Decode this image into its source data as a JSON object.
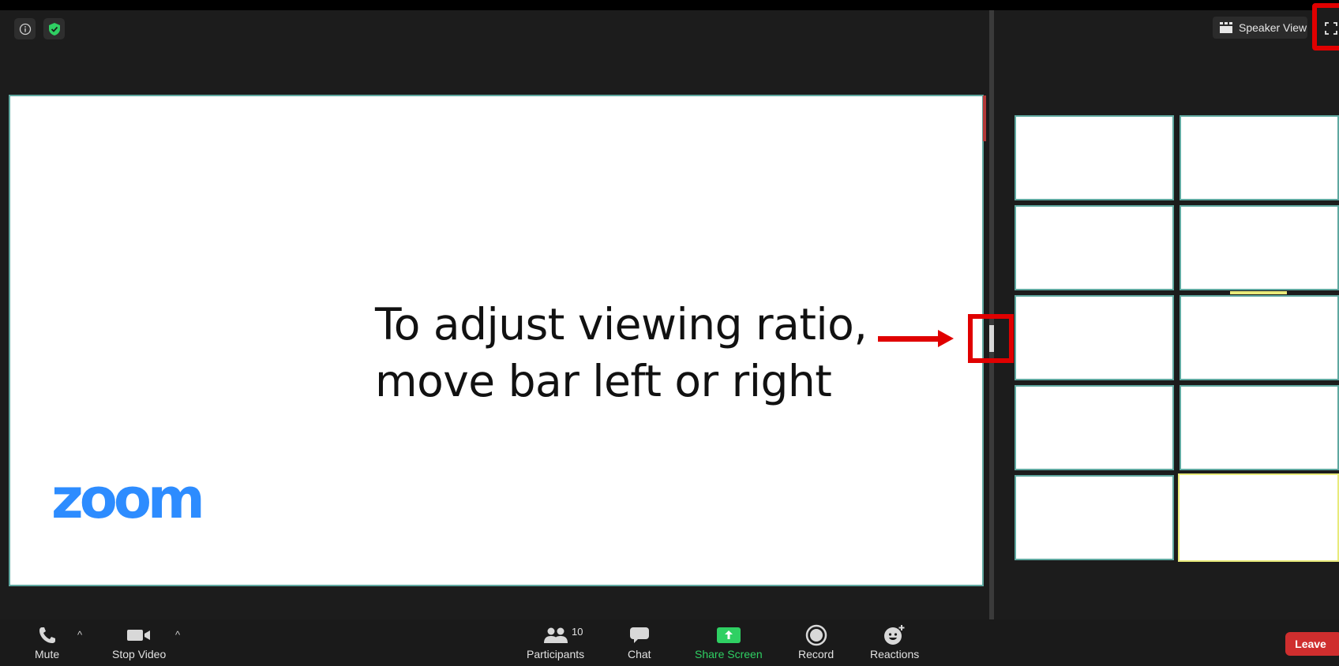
{
  "meeting": {
    "main_text_line1": "To adjust viewing ratio,",
    "main_text_line2": "move bar left or right",
    "logo_text": "zoom"
  },
  "header": {
    "info_icon": "info-icon",
    "security_icon": "shield-check-icon",
    "view_button_label": "Speaker View",
    "fullscreen_icon": "fullscreen-icon"
  },
  "gallery": {
    "tile_count": 10,
    "active_tile_index": 9
  },
  "toolbar": {
    "mute_label": "Mute",
    "stop_video_label": "Stop Video",
    "participants_label": "Participants",
    "participants_count": "10",
    "chat_label": "Chat",
    "share_screen_label": "Share Screen",
    "record_label": "Record",
    "reactions_label": "Reactions",
    "leave_label": "Leave"
  },
  "colors": {
    "background": "#1c1c1c",
    "accent_blue": "#2d8cff",
    "share_green": "#2fd063",
    "leave_red": "#cf2e2e",
    "annotation_red": "#e00000",
    "tile_border": "#5fa8a0",
    "active_speaker": "#e8ea7a"
  }
}
